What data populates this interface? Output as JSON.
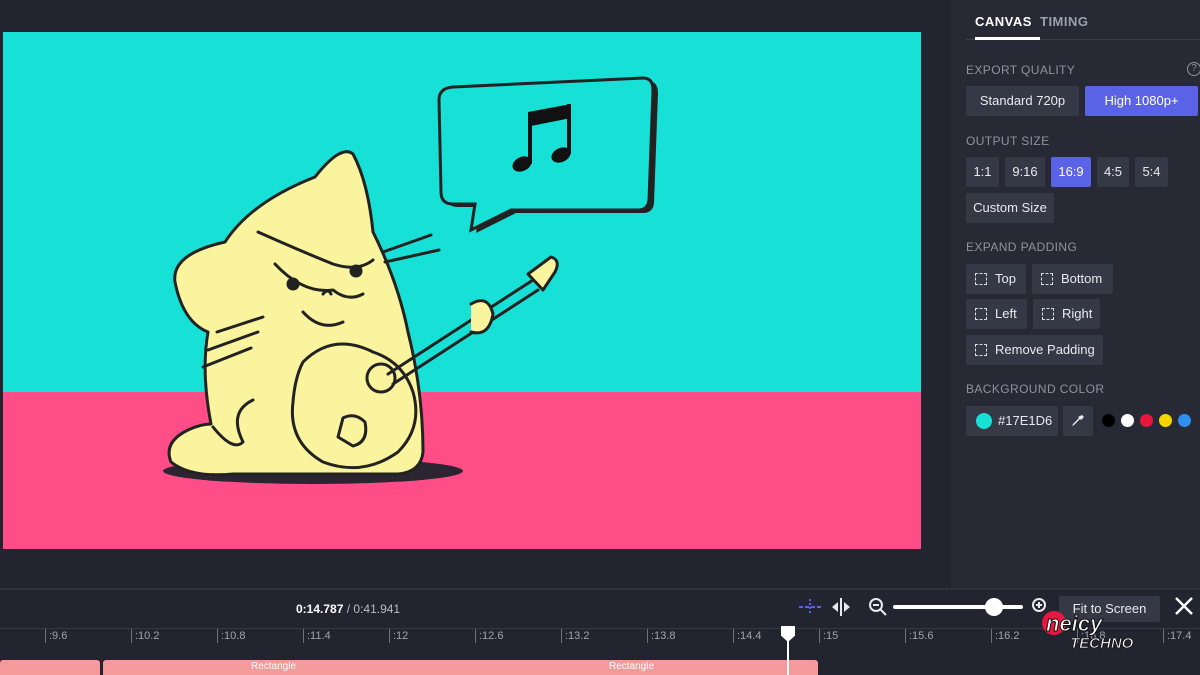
{
  "canvas": {
    "sky_color": "#17E1D6",
    "ground_color": "#FF4D87",
    "illustration": "cat-playing-guitar-with-music-note-speech-bubble"
  },
  "panel": {
    "tabs": [
      {
        "label": "CANVAS",
        "active": true
      },
      {
        "label": "TIMING",
        "active": false
      }
    ],
    "export_quality": {
      "label": "EXPORT QUALITY",
      "options": [
        "Standard 720p",
        "High 1080p+"
      ],
      "selected": "High 1080p+"
    },
    "output_size": {
      "label": "OUTPUT SIZE",
      "options": [
        "1:1",
        "9:16",
        "16:9",
        "4:5",
        "5:4"
      ],
      "selected": "16:9",
      "custom_label": "Custom Size"
    },
    "expand_padding": {
      "label": "EXPAND PADDING",
      "top": "Top",
      "bottom": "Bottom",
      "left": "Left",
      "right": "Right",
      "remove": "Remove Padding"
    },
    "background_color": {
      "label": "BACKGROUND COLOR",
      "value": "#17E1D6",
      "presets": [
        "#000000",
        "#ffffff",
        "#e8173f",
        "#f7d600",
        "#2f8ff0"
      ]
    }
  },
  "timeline": {
    "current_time": "0:14.787",
    "separator": " / ",
    "total_time": "0:41.941",
    "fit_label": "Fit to Screen",
    "zoom_level": 0.78,
    "ticks": [
      ":9.6",
      ":10.2",
      ":10.8",
      ":11.4",
      ":12",
      ":12.6",
      ":13.2",
      ":13.8",
      ":14.4",
      ":15",
      ":15.6",
      ":16.2",
      ":16.8",
      ":17.4"
    ],
    "tracks": [
      {
        "label": ""
      },
      {
        "label": "Rectangle"
      },
      {
        "label": "Rectangle"
      }
    ]
  },
  "watermark": {
    "line1": "neicy",
    "line2": "TECHNO"
  }
}
